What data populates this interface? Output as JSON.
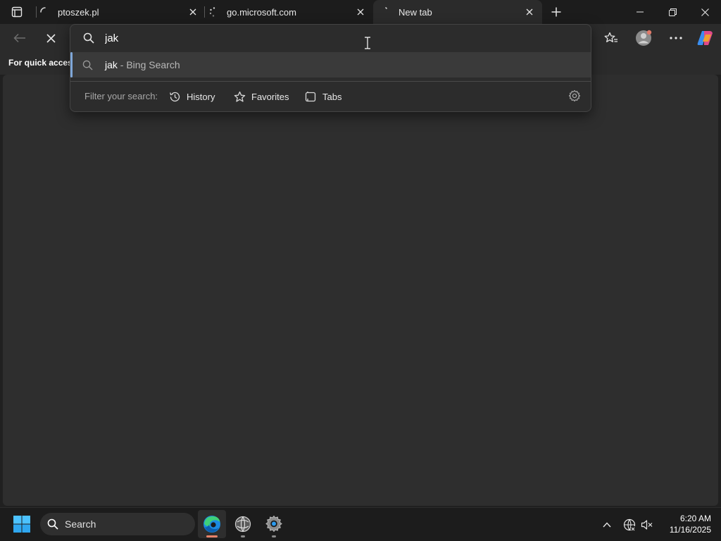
{
  "tabs": [
    {
      "title": "ptoszek.pl"
    },
    {
      "title": "go.microsoft.com"
    },
    {
      "title": "New tab"
    }
  ],
  "favorites_bar": {
    "text": "For quick access"
  },
  "omnibox": {
    "value": "jak",
    "suggestion": {
      "query": "jak",
      "suffix": " - Bing Search"
    },
    "filter_label": "Filter your search:",
    "filters": [
      {
        "label": "History",
        "icon": "history-icon"
      },
      {
        "label": "Favorites",
        "icon": "star-icon"
      },
      {
        "label": "Tabs",
        "icon": "tabs-icon"
      }
    ]
  },
  "taskbar": {
    "search_label": "Search",
    "time": "6:20 AM",
    "date": "11/16/2025"
  },
  "colors": {
    "accent": "#7fa7d8",
    "background": "#202020",
    "panel": "#2c2c2c"
  }
}
